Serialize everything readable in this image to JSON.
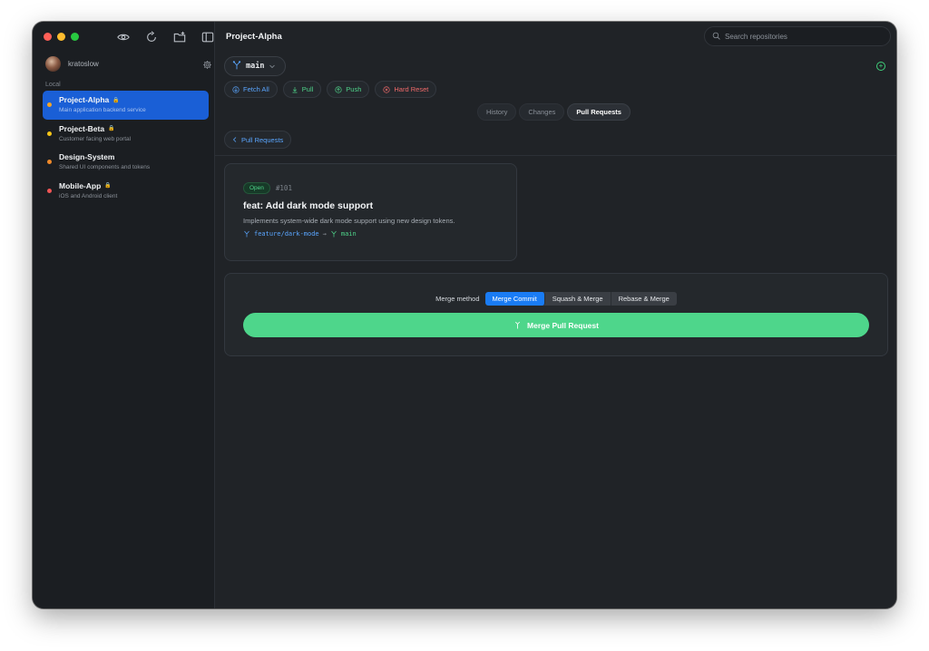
{
  "window": {
    "title": "Project-Alpha"
  },
  "colors": {
    "accent": "#1a5fd6",
    "success": "#4ed68b",
    "link": "#5aa6ff",
    "danger": "#f06a6a",
    "close": "#ff5f57",
    "minimize": "#febc2e",
    "zoom": "#28c840"
  },
  "sidebar": {
    "user": {
      "name": "kratoslow"
    },
    "section_label": "Local",
    "repos": [
      {
        "name": "Project-Alpha",
        "description": "Main application backend service",
        "locked": true,
        "dot_color": "#f5a524",
        "active": true
      },
      {
        "name": "Project-Beta",
        "description": "Customer facing web portal",
        "locked": true,
        "dot_color": "#f5c518",
        "active": false
      },
      {
        "name": "Design-System",
        "description": "Shared UI components and tokens",
        "locked": false,
        "dot_color": "#f08a2a",
        "active": false
      },
      {
        "name": "Mobile-App",
        "description": "iOS and Android client",
        "locked": true,
        "dot_color": "#f05555",
        "active": false
      }
    ]
  },
  "search": {
    "placeholder": "Search repositories"
  },
  "branch": {
    "name": "main"
  },
  "actions": [
    {
      "label": "Fetch All",
      "icon": "fetch-icon",
      "color": "#5aa6ff"
    },
    {
      "label": "Pull",
      "icon": "pull-icon",
      "color": "#4fd48a"
    },
    {
      "label": "Push",
      "icon": "push-icon",
      "color": "#4fd48a"
    },
    {
      "label": "Hard Reset",
      "icon": "reset-icon",
      "color": "#f06a6a"
    }
  ],
  "tabs": [
    {
      "label": "History",
      "active": false
    },
    {
      "label": "Changes",
      "active": false
    },
    {
      "label": "Pull Requests",
      "active": true
    }
  ],
  "back_label": "Pull Requests",
  "pull_request": {
    "status": "Open",
    "number": "#101",
    "title": "feat: Add dark mode support",
    "description": "Implements system-wide dark mode support using new design tokens.",
    "source_branch": "feature/dark-mode",
    "arrow": "→",
    "target_branch": "main"
  },
  "merge": {
    "label": "Merge method",
    "methods": [
      {
        "label": "Merge Commit",
        "active": true
      },
      {
        "label": "Squash & Merge",
        "active": false
      },
      {
        "label": "Rebase & Merge",
        "active": false
      }
    ],
    "button_label": "Merge Pull Request"
  }
}
